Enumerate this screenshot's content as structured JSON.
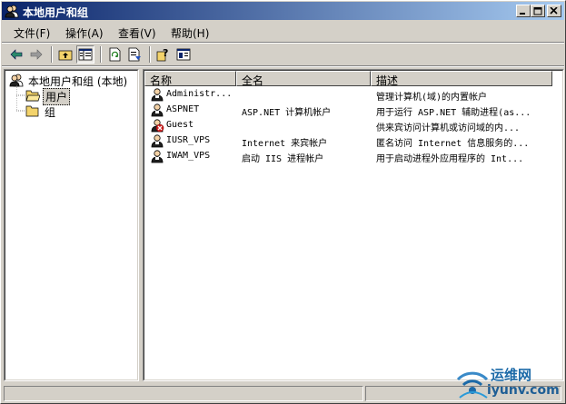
{
  "window": {
    "title": "本地用户和组",
    "controls": [
      "minimize-icon",
      "maximize-icon",
      "close-icon"
    ]
  },
  "menubar": [
    {
      "label": "文件(F)"
    },
    {
      "label": "操作(A)"
    },
    {
      "label": "查看(V)"
    },
    {
      "label": "帮助(H)"
    }
  ],
  "toolbar": [
    "back-arrow-icon",
    "forward-arrow-icon",
    "up-folder-icon",
    "show-tree-icon",
    "refresh-icon",
    "export-list-icon",
    "help-icon",
    "properties-icon"
  ],
  "tree": {
    "root": "本地用户和组 (本地)",
    "children": [
      {
        "label": "用户",
        "selected": true
      },
      {
        "label": "组",
        "selected": false
      }
    ]
  },
  "list": {
    "columns": [
      "名称",
      "全名",
      "描述"
    ],
    "rows": [
      {
        "name": "Administr...",
        "fullname": "",
        "description": "管理计算机(域)的内置帐户",
        "disabled": false
      },
      {
        "name": "ASPNET",
        "fullname": "ASP.NET 计算机帐户",
        "description": "用于运行 ASP.NET 辅助进程(as...",
        "disabled": false
      },
      {
        "name": "Guest",
        "fullname": "",
        "description": "供来宾访问计算机或访问域的内...",
        "disabled": true
      },
      {
        "name": "IUSR_VPS",
        "fullname": "Internet 来宾帐户",
        "description": "匿名访问 Internet 信息服务的...",
        "disabled": false
      },
      {
        "name": "IWAM_VPS",
        "fullname": "启动 IIS 进程帐户",
        "description": "用于启动进程外应用程序的 Int...",
        "disabled": false
      }
    ]
  },
  "watermark": {
    "line1": "运维网",
    "line2": "iyunv.com"
  },
  "colors": {
    "titlebar_start": "#0a246a",
    "titlebar_end": "#a6caf0",
    "face": "#d4d0c8",
    "watermark": "#1c6aa8"
  }
}
